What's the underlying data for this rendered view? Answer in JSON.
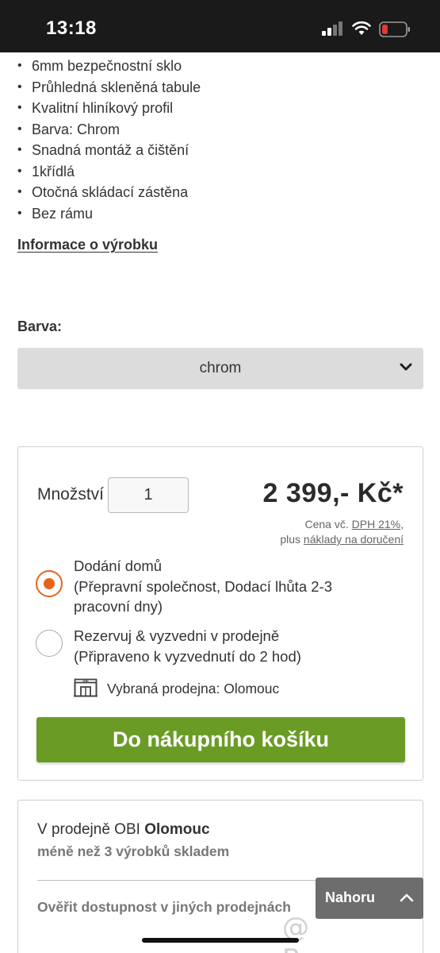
{
  "status_bar": {
    "time": "13:18"
  },
  "features": [
    "6mm bezpečnostní sklo",
    "Průhledná skleněná tabule",
    "Kvalitní hliníkový profil",
    "Barva: Chrom",
    "Snadná montáž a čištění",
    "1křídlá",
    "Otočná skládací zástěna",
    "Bez rámu"
  ],
  "info_link": "Informace o výrobku",
  "color": {
    "label": "Barva:",
    "selected": "chrom"
  },
  "buy_box": {
    "quantity_label": "Množství",
    "quantity_value": "1",
    "price": "2 399,- Kč*",
    "price_note_prefix": "Cena vč.",
    "vat_link": "DPH 21%",
    "price_note_plus": "plus",
    "delivery_link": "náklady na doručení",
    "delivery_option": {
      "title": "Dodání domů",
      "line2": "(Přepravní společnost, Dodací lhůta 2-3",
      "line3": "pracovní dny)",
      "selected": true
    },
    "pickup_option": {
      "title": "Rezervuj & vyzvedni v prodejně",
      "line2": "(Připraveno k vyzvednutí do 2 hod)",
      "selected": false
    },
    "store_text": "Vybraná prodejna: Olomouc",
    "cart_button": "Do nákupního košíku"
  },
  "stock": {
    "prefix": "V prodejně OBI",
    "store": "Olomouc",
    "availability": "méně než 3 výrobků skladem",
    "check_link": "Ověřit dostupnost v jiných prodejnách"
  },
  "scroll_top_button": "Nahoru",
  "watermark": "@ Bazos.cz",
  "colors": {
    "accent_orange": "#e8631c",
    "button_green": "#6a9c25",
    "top_button_gray": "#6d6d6d",
    "battery_low": "#e53935"
  }
}
